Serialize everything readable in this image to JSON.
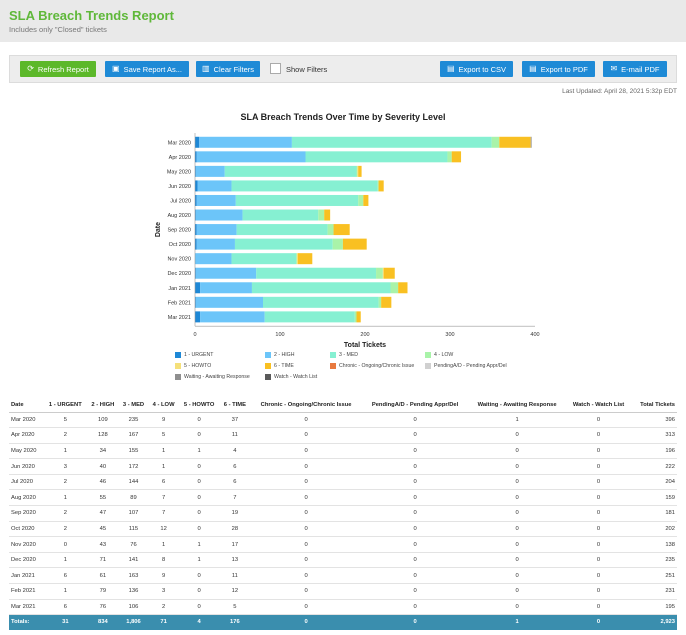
{
  "header": {
    "title": "SLA Breach Trends Report",
    "subtitle": "Includes only \"Closed\" tickets"
  },
  "toolbar": {
    "refresh_label": "Refresh Report",
    "save_label": "Save Report As...",
    "clear_label": "Clear Filters",
    "show_filters_label": "Show Filters",
    "csv_label": "Export to CSV",
    "pdf_label": "Export to PDF",
    "email_label": "E-mail PDF"
  },
  "last_updated": "Last Updated: April 28, 2021 5:32p EDT",
  "colors": {
    "urgent": "#1e88d6",
    "high": "#6cc5f9",
    "med": "#86f0d2",
    "low": "#a9f3a9",
    "howto": "#f5e07a",
    "time": "#f9c022",
    "chronic": "#e8793f",
    "pending": "#d0d0d0",
    "waiting": "#8f8f8f",
    "watch": "#5a5a5a"
  },
  "chart_data": {
    "type": "bar",
    "orientation": "horizontal",
    "stacked": true,
    "title": "SLA Breach Trends Over Time by Severity Level",
    "xlabel": "Total Tickets",
    "ylabel": "Date",
    "xlim": [
      0,
      400
    ],
    "xticks": [
      "0",
      "100",
      "200",
      "300",
      "400"
    ],
    "categories": [
      "Mar 2020",
      "Apr 2020",
      "May 2020",
      "Jun 2020",
      "Jul 2020",
      "Aug 2020",
      "Sep 2020",
      "Oct 2020",
      "Nov 2020",
      "Dec 2020",
      "Jan 2021",
      "Feb 2021",
      "Mar 2021"
    ],
    "series": [
      {
        "name": "1 - URGENT",
        "color": "#1e88d6",
        "values": [
          5,
          2,
          1,
          3,
          2,
          1,
          2,
          2,
          0,
          1,
          6,
          1,
          6
        ]
      },
      {
        "name": "2 - HIGH",
        "color": "#6cc5f9",
        "values": [
          109,
          128,
          34,
          40,
          46,
          55,
          47,
          45,
          43,
          71,
          61,
          79,
          76
        ]
      },
      {
        "name": "3 - MED",
        "color": "#86f0d2",
        "values": [
          235,
          167,
          155,
          172,
          144,
          89,
          107,
          115,
          76,
          141,
          163,
          136,
          106
        ]
      },
      {
        "name": "4 - LOW",
        "color": "#a9f3a9",
        "values": [
          9,
          5,
          1,
          1,
          6,
          7,
          7,
          12,
          1,
          8,
          9,
          3,
          2
        ]
      },
      {
        "name": "5 - HOWTO",
        "color": "#f5e07a",
        "values": [
          0,
          0,
          1,
          0,
          0,
          0,
          0,
          0,
          1,
          1,
          0,
          0,
          0
        ]
      },
      {
        "name": "6 - TIME",
        "color": "#f9c022",
        "values": [
          37,
          11,
          4,
          6,
          6,
          7,
          19,
          28,
          17,
          13,
          11,
          12,
          5
        ]
      },
      {
        "name": "Chronic - Ongoing/Chronic Issue",
        "color": "#e8793f",
        "values": [
          0,
          0,
          0,
          0,
          0,
          0,
          0,
          0,
          0,
          0,
          0,
          0,
          0
        ]
      },
      {
        "name": "PendingA/D - Pending Appr/Del",
        "color": "#d0d0d0",
        "values": [
          0,
          0,
          0,
          0,
          0,
          0,
          0,
          0,
          0,
          0,
          0,
          0,
          0
        ]
      },
      {
        "name": "Waiting - Awaiting Response",
        "color": "#8f8f8f",
        "values": [
          1,
          0,
          0,
          0,
          0,
          0,
          0,
          0,
          0,
          0,
          0,
          0,
          0
        ]
      },
      {
        "name": "Watch - Watch List",
        "color": "#5a5a5a",
        "values": [
          0,
          0,
          0,
          0,
          0,
          0,
          0,
          0,
          0,
          0,
          0,
          0,
          0
        ]
      }
    ]
  },
  "table": {
    "headers": [
      "Date",
      "1 - URGENT",
      "2 - HIGH",
      "3 - MED",
      "4 - LOW",
      "5 - HOWTO",
      "6 - TIME",
      "Chronic - Ongoing/Chronic Issue",
      "PendingA/D - Pending Appr/Del",
      "Waiting - Awaiting Response",
      "Watch - Watch List",
      "Total Tickets"
    ],
    "rows": [
      [
        "Mar 2020",
        "5",
        "109",
        "235",
        "9",
        "0",
        "37",
        "0",
        "0",
        "1",
        "0",
        "396"
      ],
      [
        "Apr 2020",
        "2",
        "128",
        "167",
        "5",
        "0",
        "11",
        "0",
        "0",
        "0",
        "0",
        "313"
      ],
      [
        "May 2020",
        "1",
        "34",
        "155",
        "1",
        "1",
        "4",
        "0",
        "0",
        "0",
        "0",
        "196"
      ],
      [
        "Jun 2020",
        "3",
        "40",
        "172",
        "1",
        "0",
        "6",
        "0",
        "0",
        "0",
        "0",
        "222"
      ],
      [
        "Jul 2020",
        "2",
        "46",
        "144",
        "6",
        "0",
        "6",
        "0",
        "0",
        "0",
        "0",
        "204"
      ],
      [
        "Aug 2020",
        "1",
        "55",
        "89",
        "7",
        "0",
        "7",
        "0",
        "0",
        "0",
        "0",
        "159"
      ],
      [
        "Sep 2020",
        "2",
        "47",
        "107",
        "7",
        "0",
        "19",
        "0",
        "0",
        "0",
        "0",
        "181"
      ],
      [
        "Oct 2020",
        "2",
        "45",
        "115",
        "12",
        "0",
        "28",
        "0",
        "0",
        "0",
        "0",
        "202"
      ],
      [
        "Nov 2020",
        "0",
        "43",
        "76",
        "1",
        "1",
        "17",
        "0",
        "0",
        "0",
        "0",
        "138"
      ],
      [
        "Dec 2020",
        "1",
        "71",
        "141",
        "8",
        "1",
        "13",
        "0",
        "0",
        "0",
        "0",
        "235"
      ],
      [
        "Jan 2021",
        "6",
        "61",
        "163",
        "9",
        "0",
        "11",
        "0",
        "0",
        "0",
        "0",
        "251"
      ],
      [
        "Feb 2021",
        "1",
        "79",
        "136",
        "3",
        "0",
        "12",
        "0",
        "0",
        "0",
        "0",
        "231"
      ],
      [
        "Mar 2021",
        "6",
        "76",
        "106",
        "2",
        "0",
        "5",
        "0",
        "0",
        "0",
        "0",
        "195"
      ]
    ],
    "totals": [
      "Totals:",
      "31",
      "834",
      "1,806",
      "71",
      "4",
      "176",
      "0",
      "0",
      "1",
      "0",
      "2,923"
    ]
  }
}
